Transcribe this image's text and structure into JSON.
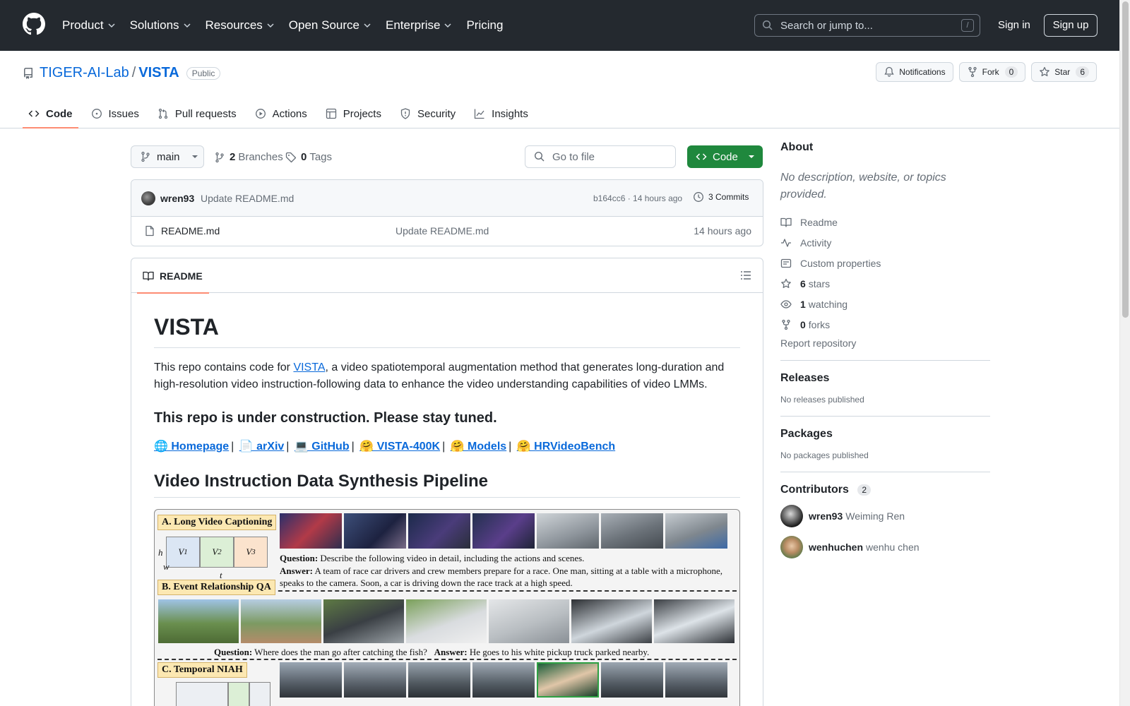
{
  "header": {
    "nav": [
      "Product",
      "Solutions",
      "Resources",
      "Open Source",
      "Enterprise",
      "Pricing"
    ],
    "search_placeholder": "Search or jump to...",
    "search_shortcut": "/",
    "sign_in": "Sign in",
    "sign_up": "Sign up"
  },
  "repo": {
    "owner": "TIGER-AI-Lab",
    "separator": "/",
    "name": "VISTA",
    "visibility": "Public",
    "notifications_label": "Notifications",
    "fork_label": "Fork",
    "fork_count": "0",
    "star_label": "Star",
    "star_count": "6"
  },
  "tabs": [
    "Code",
    "Issues",
    "Pull requests",
    "Actions",
    "Projects",
    "Security",
    "Insights"
  ],
  "toolbar": {
    "branch": "main",
    "branches_count": "2",
    "branches_label": "Branches",
    "tags_count": "0",
    "tags_label": "Tags",
    "goto_file_placeholder": "Go to file",
    "code_button": "Code"
  },
  "commit": {
    "author": "wren93",
    "message": "Update README.md",
    "hash_time": "b164cc6 · 14 hours ago",
    "commits_label": "3 Commits"
  },
  "files": [
    {
      "name": "README.md",
      "message": "Update README.md",
      "time": "14 hours ago"
    }
  ],
  "readme": {
    "tab_label": "README",
    "title": "VISTA",
    "intro_before": "This repo contains code for ",
    "intro_link": "VISTA",
    "intro_after": ", a video spatiotemporal augmentation method that generates long-duration and high-resolution video instruction-following data to enhance the video understanding capabilities of video LMMs.",
    "construction": "This repo is under construction. Please stay tuned.",
    "links": [
      "🌐 Homepage",
      "📄 arXiv",
      "💻 GitHub",
      "🤗 VISTA-400K",
      "🤗 Models",
      "🤗 HRVideoBench"
    ],
    "link_separator": "|",
    "section_title": "Video Instruction Data Synthesis Pipeline",
    "figure": {
      "label_a": "A. Long Video Captioning",
      "label_b": "B. Event Relationship QA",
      "label_c": "C. Temporal NIAH",
      "v1": "V",
      "v1_sub": "1",
      "v2": "V",
      "v2_sub": "2",
      "v3": "V",
      "v3_sub": "3",
      "h": "h",
      "w": "w",
      "t": "t",
      "q_a_label": "Question:",
      "q_a": " Describe the following video in detail, including the actions and scenes.",
      "ans_a_label": "Answer:",
      "ans_a": " A team of race car drivers and crew members prepare for a race. One man, sitting at a table with a microphone, speaks to the camera. Soon, a car is driving down the race track at a high speed.",
      "q_b_label": "Question:",
      "q_b": " Where does the man go after catching the fish?",
      "ans_b_label": "Answer:",
      "ans_b": " He goes to his white pickup truck parked nearby."
    }
  },
  "sidebar": {
    "about_title": "About",
    "about_desc": "No description, website, or topics provided.",
    "items": [
      {
        "icon": "book-icon",
        "bold": "",
        "text": "Readme"
      },
      {
        "icon": "pulse-icon",
        "bold": "",
        "text": "Activity"
      },
      {
        "icon": "note-icon",
        "bold": "",
        "text": "Custom properties"
      },
      {
        "icon": "star-icon",
        "bold": "6",
        "text": "stars"
      },
      {
        "icon": "eye-icon",
        "bold": "1",
        "text": "watching"
      },
      {
        "icon": "fork-icon",
        "bold": "0",
        "text": "forks"
      }
    ],
    "report": "Report repository",
    "releases_title": "Releases",
    "releases_empty": "No releases published",
    "packages_title": "Packages",
    "packages_empty": "No packages published",
    "contributors_title": "Contributors",
    "contributors_count": "2",
    "contributors": [
      {
        "login": "wren93",
        "name": "Weiming Ren"
      },
      {
        "login": "wenhuchen",
        "name": "wenhu chen"
      }
    ]
  },
  "colors": {
    "header_bg": "#24292f",
    "link": "#0969da",
    "green": "#1f883d",
    "tab_underline": "#fd8c73"
  }
}
